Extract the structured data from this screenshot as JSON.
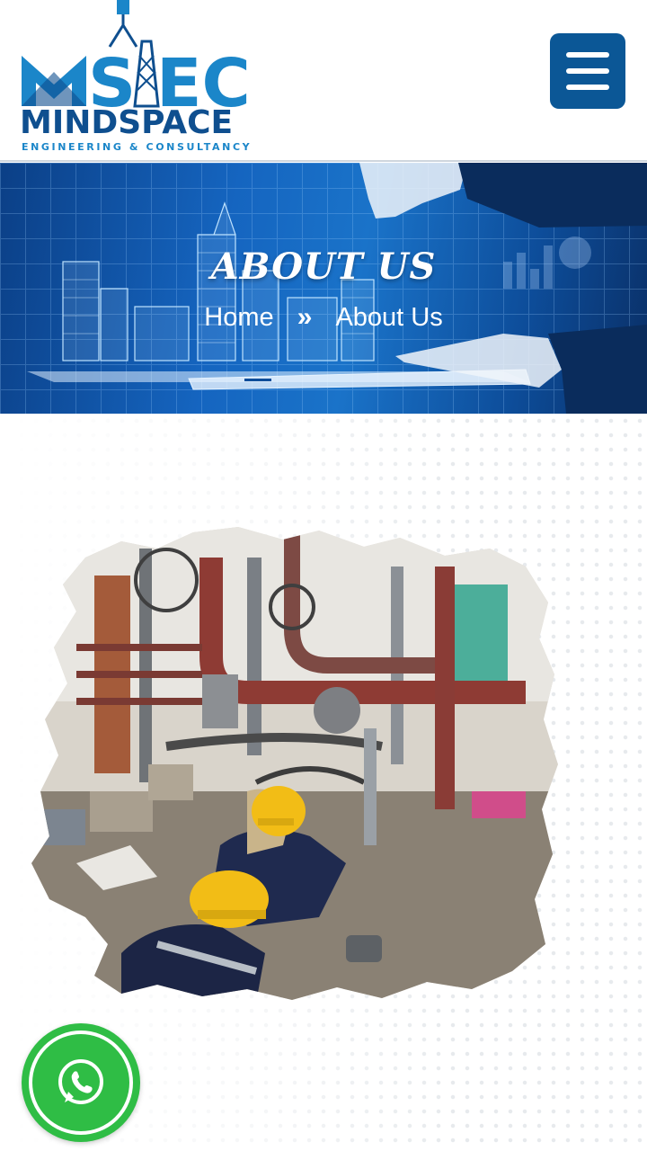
{
  "header": {
    "logo": {
      "mark": "MSEC",
      "name": "MINDSPACE",
      "tagline": "ENGINEERING & CONSULTANCY"
    },
    "menu_icon": "hamburger-menu-icon"
  },
  "hero": {
    "title": "ABOUT US",
    "breadcrumb": {
      "home": "Home",
      "separator": "»",
      "current": "About Us"
    }
  },
  "content": {
    "image": "industrial-pipework-workers-photo"
  },
  "floating": {
    "whatsapp_icon": "whatsapp-icon"
  },
  "colors": {
    "brand_blue": "#0b5796",
    "accent_cyan": "#1aa0e0",
    "whatsapp_green": "#2fbd45"
  }
}
